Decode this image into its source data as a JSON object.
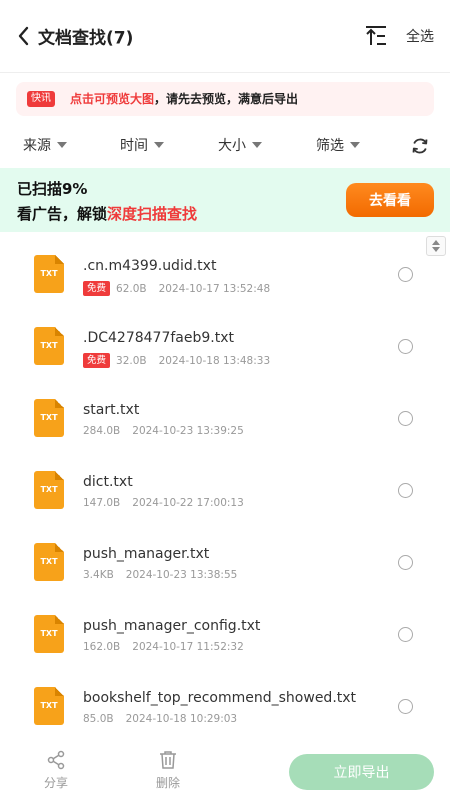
{
  "header": {
    "title": "文档查找(7)",
    "select_all": "全选"
  },
  "notice": {
    "tag": "快讯",
    "highlight": "点击可预览大图",
    "text": "，请先去预览，满意后导出"
  },
  "filters": {
    "source": "来源",
    "time": "时间",
    "size": "大小",
    "filter": "筛选"
  },
  "scan": {
    "progress_text": "已扫描9%",
    "ad_prefix": "看广告，解锁",
    "ad_highlight": "深度扫描查找",
    "button": "去看看"
  },
  "files": [
    {
      "ext": "TXT",
      "name": ".cn.m4399.udid.txt",
      "badge": "免费",
      "size": "62.0B",
      "date": "2024-10-17 13:52:48"
    },
    {
      "ext": "TXT",
      "name": ".DC4278477faeb9.txt",
      "badge": "免费",
      "size": "32.0B",
      "date": "2024-10-18 13:48:33"
    },
    {
      "ext": "TXT",
      "name": "start.txt",
      "badge": "",
      "size": "284.0B",
      "date": "2024-10-23 13:39:25"
    },
    {
      "ext": "TXT",
      "name": "dict.txt",
      "badge": "",
      "size": "147.0B",
      "date": "2024-10-22 17:00:13"
    },
    {
      "ext": "TXT",
      "name": "push_manager.txt",
      "badge": "",
      "size": "3.4KB",
      "date": "2024-10-23 13:38:55"
    },
    {
      "ext": "TXT",
      "name": "push_manager_config.txt",
      "badge": "",
      "size": "162.0B",
      "date": "2024-10-17 11:52:32"
    },
    {
      "ext": "TXT",
      "name": "bookshelf_top_recommend_showed.txt",
      "badge": "",
      "size": "85.0B",
      "date": "2024-10-18 10:29:03"
    }
  ],
  "bottom": {
    "share": "分享",
    "delete": "删除",
    "export": "立即导出"
  },
  "colors": {
    "accent_red": "#ef3b3b",
    "orange": "#f26a00",
    "banner_green": "#e3fbef",
    "export_green": "#a6ddb8",
    "file_orange": "#f7a21a"
  }
}
